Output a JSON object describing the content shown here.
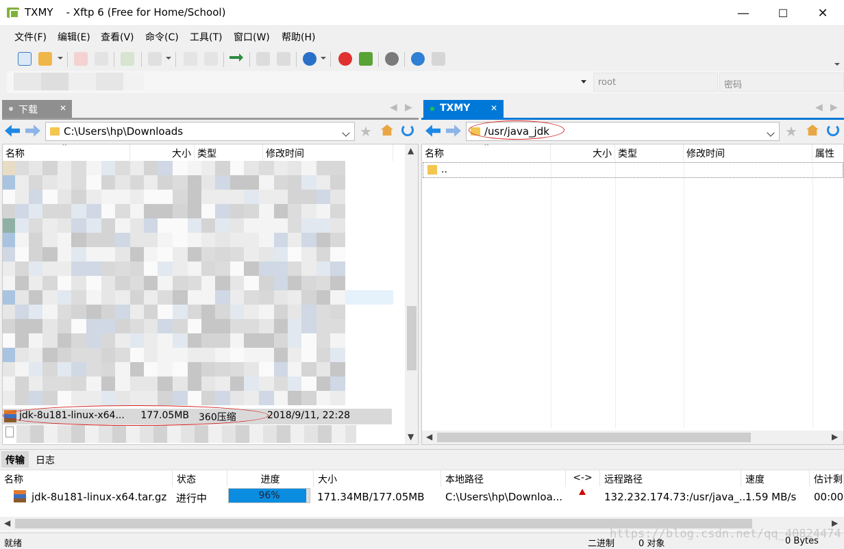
{
  "window": {
    "title": "TXMY    - Xftp 6 (Free for Home/School)",
    "minimize_glyph": "—",
    "maximize_glyph": "☐",
    "close_glyph": "✕"
  },
  "menu": [
    "文件(F)",
    "编辑(E)",
    "查看(V)",
    "命令(C)",
    "工具(T)",
    "窗口(W)",
    "帮助(H)"
  ],
  "address": {
    "user_placeholder": "root",
    "password_placeholder": "密码"
  },
  "left_pane": {
    "tab_label": "下载",
    "path": "C:\\Users\\hp\\Downloads",
    "columns": [
      "名称",
      "大小",
      "类型",
      "修改时间"
    ],
    "selected_file": {
      "name": "jdk-8u181-linux-x64...",
      "size": "177.05MB",
      "type": "360压缩",
      "modified": "2018/9/11, 22:28"
    }
  },
  "right_pane": {
    "tab_label": "TXMY",
    "path": "/usr/java_jdk",
    "columns": [
      "名称",
      "大小",
      "类型",
      "修改时间",
      "属性"
    ],
    "rows": [
      {
        "name": ".."
      }
    ]
  },
  "transfer": {
    "tabs": [
      "传输",
      "日志"
    ],
    "columns": [
      "名称",
      "状态",
      "进度",
      "大小",
      "本地路径",
      "<->",
      "远程路径",
      "速度",
      "估计剩"
    ],
    "row": {
      "name": "jdk-8u181-linux-x64.tar.gz",
      "status": "进行中",
      "progress": 96,
      "progress_text": "96%",
      "size": "171.34MB/177.05MB",
      "local_path": "C:\\Users\\hp\\Downloa...",
      "remote_path": "132.232.174.73:/usr/java_...",
      "speed": "1.59 MB/s",
      "eta": "00:00:"
    }
  },
  "status": {
    "left": "就绪",
    "mode": "二进制",
    "objects": "0 对象",
    "bytes": "0 Bytes"
  },
  "watermark": "https://blog.csdn.net/qq_40824474",
  "colors": {
    "accent": "#0078d7",
    "progress": "#0a8de0",
    "annotation": "#d42020"
  }
}
